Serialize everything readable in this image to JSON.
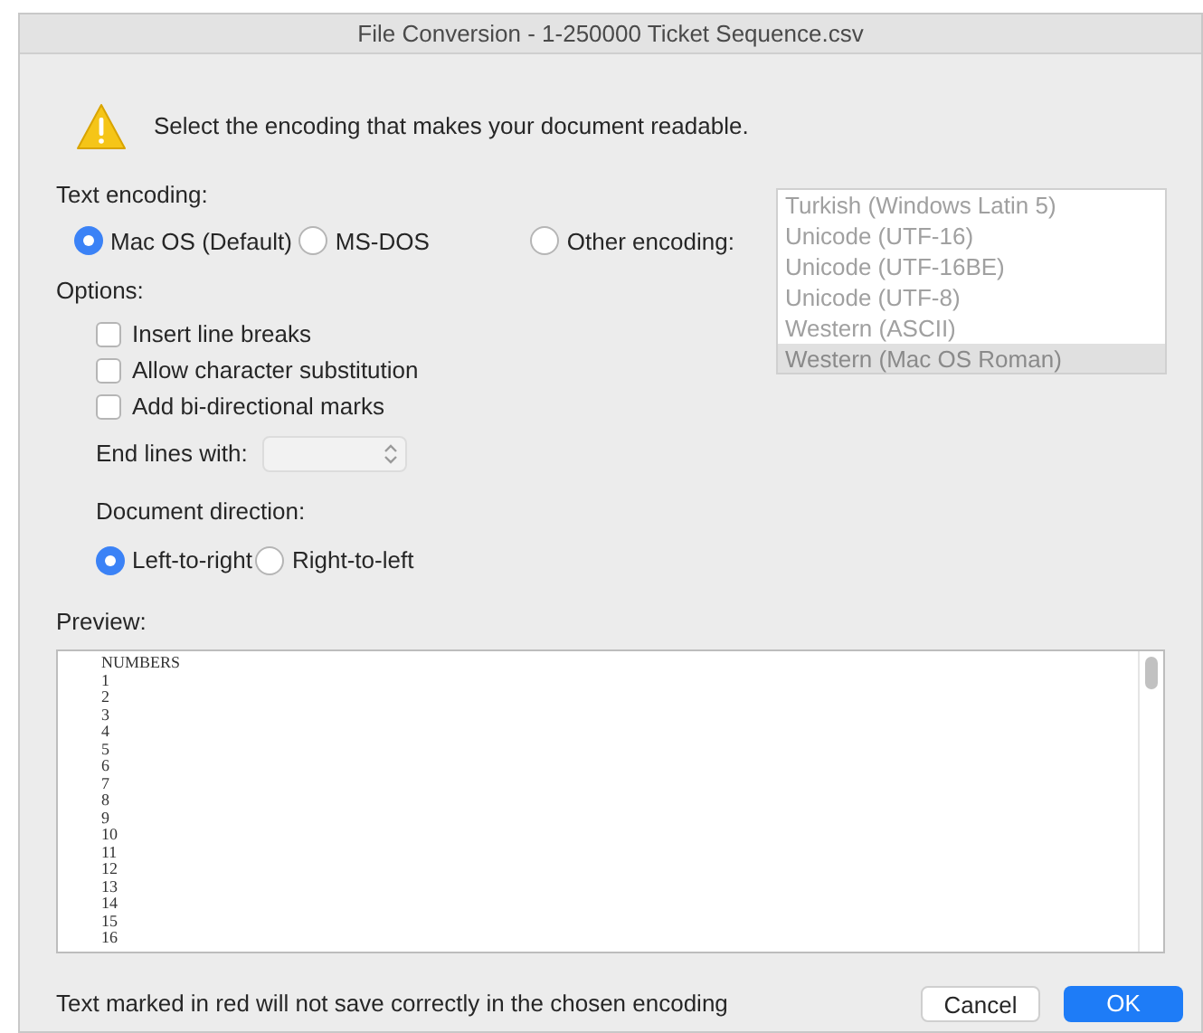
{
  "window": {
    "title": "File Conversion - 1-250000 Ticket Sequence.csv"
  },
  "message": "Select the encoding that makes your document readable.",
  "text_encoding": {
    "label": "Text encoding:",
    "options": [
      {
        "label": "Mac OS (Default)",
        "selected": true
      },
      {
        "label": "MS-DOS",
        "selected": false
      },
      {
        "label": "Other encoding:",
        "selected": false
      }
    ],
    "encoding_list": {
      "disabled": true,
      "items": [
        {
          "label": "Turkish (Windows Latin 5)",
          "selected": false
        },
        {
          "label": "Unicode (UTF-16)",
          "selected": false
        },
        {
          "label": "Unicode (UTF-16BE)",
          "selected": false
        },
        {
          "label": "Unicode (UTF-8)",
          "selected": false
        },
        {
          "label": "Western (ASCII)",
          "selected": false
        },
        {
          "label": "Western (Mac OS Roman)",
          "selected": true
        }
      ]
    }
  },
  "options": {
    "label": "Options:",
    "checkboxes": [
      {
        "label": "Insert line breaks",
        "checked": false
      },
      {
        "label": "Allow character substitution",
        "checked": false
      },
      {
        "label": "Add bi-directional marks",
        "checked": false
      }
    ],
    "end_lines": {
      "label": "End lines with:"
    },
    "direction": {
      "label": "Document direction:",
      "options": [
        {
          "label": "Left-to-right",
          "selected": true
        },
        {
          "label": "Right-to-left",
          "selected": false
        }
      ]
    }
  },
  "preview": {
    "label": "Preview:",
    "lines": [
      "NUMBERS",
      "1",
      "2",
      "3",
      "4",
      "5",
      "6",
      "7",
      "8",
      "9",
      "10",
      "11",
      "12",
      "13",
      "14",
      "15",
      "16"
    ]
  },
  "footer": {
    "note": "Text marked in red will not save correctly in the chosen encoding",
    "buttons": [
      {
        "label": "Cancel",
        "kind": "secondary"
      },
      {
        "label": "OK",
        "kind": "primary"
      }
    ]
  }
}
